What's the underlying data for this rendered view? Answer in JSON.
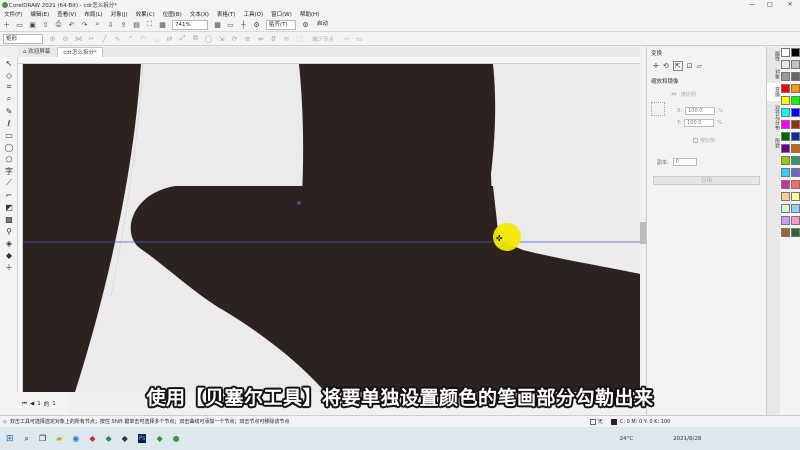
{
  "window": {
    "title": "CorelDRAW 2021 (64-Bit) - cdr怎么拆分*",
    "minimize": "—",
    "maximize": "□",
    "close": "✕"
  },
  "menu": [
    "文件(F)",
    "编辑(E)",
    "查看(V)",
    "布局(L)",
    "对象(J)",
    "效果(C)",
    "位图(B)",
    "文本(X)",
    "表格(T)",
    "工具(O)",
    "窗口(W)",
    "帮助(H)"
  ],
  "toolbar": {
    "zoom": "741%",
    "snap": "贴齐(T)",
    "launch": "启动"
  },
  "propbar": {
    "shape_mode": "矩形",
    "node_label": "减少节点"
  },
  "tabs": [
    {
      "label": "欢迎屏幕",
      "active": false
    },
    {
      "label": "cdr怎么拆分*",
      "active": true
    }
  ],
  "pages": {
    "current": "1",
    "of": "的",
    "total": "1"
  },
  "docker": {
    "title": "变换",
    "section": "缩放和镜像",
    "proportional": "按比例",
    "x_label": "X:",
    "x_value": "100.0",
    "y_label": "Y:",
    "y_value": "100.0",
    "lock": "按比例",
    "copies_label": "副本:",
    "copies_value": "0",
    "apply": "应用",
    "x_unit": "%",
    "y_unit": "%"
  },
  "side_tabs": [
    "属性",
    "对象",
    "变换",
    "对齐与分布",
    "形状"
  ],
  "status": {
    "hint": "双击工具可选择选定对象上的所有节点；按住 Shift 键单击可选择多个节点；双击曲线可添加一个节点；双击节点可移除该节点",
    "fill": "无",
    "color_info": "C: 0 M: 0 Y: 0 K: 100"
  },
  "subtitle": "使用【贝塞尔工具】将要单独设置颜色的笔画部分勾勒出来",
  "taskbar": {
    "temp": "24°C",
    "date": "2021/8/28"
  },
  "colors": {
    "glyph": "#2c2220",
    "guide": "#4a59c8",
    "highlight": "#f6e800"
  },
  "palette": [
    "#ffffff",
    "#000000",
    "#e6e6e6",
    "#c0c0c0",
    "#999999",
    "#666666",
    "#ff0000",
    "#ff9900",
    "#ffff00",
    "#00ff00",
    "#00ffff",
    "#0000ff",
    "#ff00ff",
    "#993300",
    "#006600",
    "#003399",
    "#660099",
    "#cc6600",
    "#99cc00",
    "#339966",
    "#33ccff",
    "#6666cc",
    "#cc3399",
    "#ff6666",
    "#ffcc99",
    "#ffff99",
    "#ccffcc",
    "#99ccff",
    "#cc99ff",
    "#ff99cc",
    "#996633",
    "#336633"
  ]
}
